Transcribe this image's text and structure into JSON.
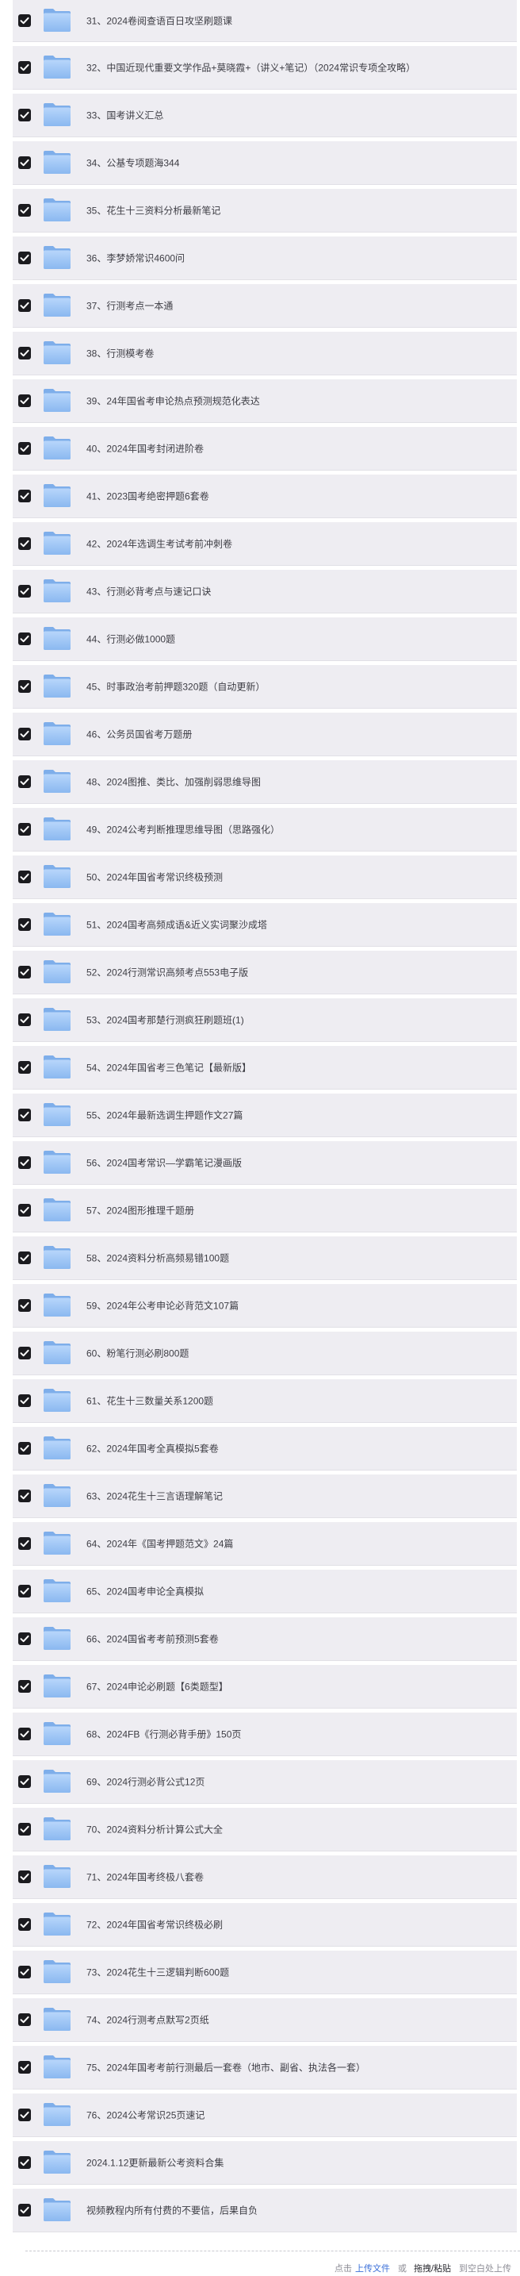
{
  "items": [
    "31、2024卷阅查语百日攻坚刷题课",
    "32、中国近现代重要文学作品+莫晓霞+（讲义+笔记）（2024常识专项全攻略）",
    "33、国考讲义汇总",
    "34、公基专项题海344",
    "35、花生十三资料分析最新笔记",
    "36、李梦娇常识4600问",
    "37、行测考点一本通",
    "38、行测模考卷",
    "39、24年国省考申论热点预测规范化表达",
    "40、2024年国考封闭进阶卷",
    "41、2023国考绝密押题6套卷",
    "42、2024年选调生考试考前冲刺卷",
    "43、行测必背考点与速记口诀",
    "44、行测必做1000题",
    "45、时事政治考前押题320题（自动更新）",
    "46、公务员国省考万题册",
    "48、2024图推、类比、加强削弱思维导图",
    "49、2024公考判断推理思维导图（思路强化）",
    "50、2024年国省考常识终极预测",
    "51、2024国考高频成语&近义实词聚沙成塔",
    "52、2024行测常识高频考点553电子版",
    "53、2024国考那楚行测疯狂刷题班(1)",
    "54、2024年国省考三色笔记【最新版】",
    "55、2024年最新选调生押题作文27篇",
    "56、2024国考常识—学霸笔记漫画版",
    "57、2024图形推理千题册",
    "58、2024资料分析高频易错100题",
    "59、2024年公考申论必背范文107篇",
    "60、粉笔行测必刷800题",
    "61、花生十三数量关系1200题",
    "62、2024年国考全真模拟5套卷",
    "63、2024花生十三言语理解笔记",
    "64、2024年《国考押题范文》24篇",
    "65、2024国考申论全真模拟",
    "66、2024国省考考前预测5套卷",
    "67、2024申论必刷题【6类题型】",
    "68、2024FB《行测必背手册》150页",
    "69、2024行测必背公式12页",
    "70、2024资料分析计算公式大全",
    "71、2024年国考终极八套卷",
    "72、2024年国省考常识终极必刷",
    "73、2024花生十三逻辑判断600题",
    "74、2024行测考点默写2页纸",
    "75、2024年国考考前行测最后一套卷（地市、副省、执法各一套）",
    "76、2024公考常识25页速记",
    "2024.1.12更新最新公考资料合集",
    "视频教程内所有付费的不要信，后果自负"
  ],
  "footer": {
    "hint": "点击",
    "upload_link": "上传文件",
    "or": "或",
    "drag": "拖拽/粘贴",
    "tail": "到空白处上传"
  },
  "colors": {
    "row_bg": "#eeedf2",
    "checkbox": "#1b1b1f",
    "folder": "#9ec4f4",
    "link": "#3a6fd8"
  },
  "icons": {
    "row_checkbox": "checkbox-checked-icon",
    "row_type": "folder-icon"
  }
}
